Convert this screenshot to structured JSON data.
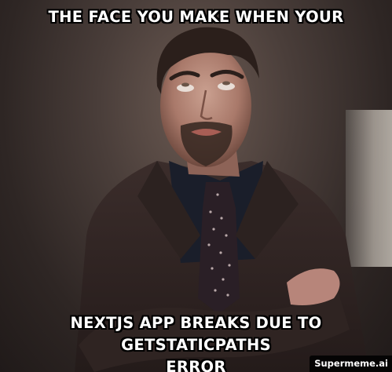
{
  "meme": {
    "top_text": "THE FACE YOU MAKE WHEN YOUR",
    "bottom_text_line1": "NEXTJS APP BREAKS DUE TO GETSTATICPATHS",
    "bottom_text_line2": "ERROR",
    "image_subject": "man-rolling-eyes-arms-crossed"
  },
  "watermark": "Supermeme.ai",
  "colors": {
    "caption_text": "#ffffff",
    "caption_outline": "#000000",
    "background": "#3a302d"
  }
}
